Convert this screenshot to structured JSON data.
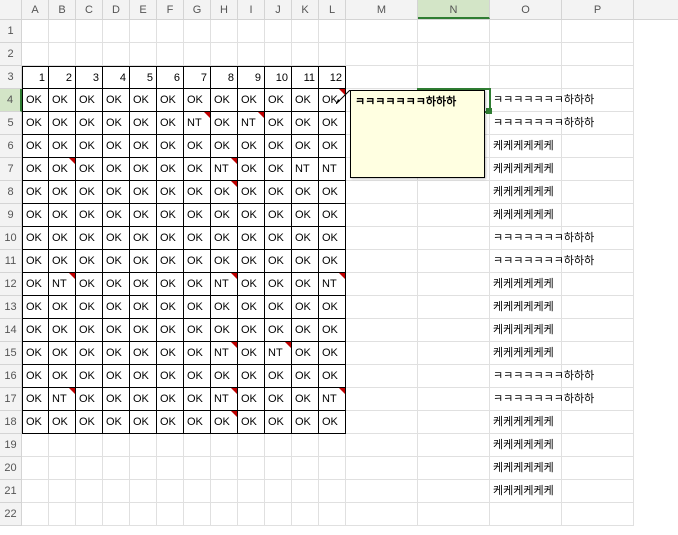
{
  "columns": [
    "A",
    "B",
    "C",
    "D",
    "E",
    "F",
    "G",
    "H",
    "I",
    "J",
    "K",
    "L",
    "M",
    "N",
    "O",
    "P"
  ],
  "col_widths": {
    "narrow": [
      "A",
      "B",
      "C",
      "D",
      "E",
      "F",
      "G",
      "H",
      "I",
      "J",
      "K",
      "L"
    ],
    "wide": [
      "M",
      "N",
      "O",
      "P"
    ]
  },
  "active_cell": "N4",
  "comment": {
    "anchor": "L4",
    "text": "ㅋㅋㅋㅋㅋㅋㅋ하하하"
  },
  "headers_row3": [
    "1",
    "2",
    "3",
    "4",
    "5",
    "6",
    "7",
    "8",
    "9",
    "10",
    "11",
    "12"
  ],
  "grid": {
    "4": {
      "cells": [
        "OK",
        "OK",
        "OK",
        "OK",
        "OK",
        "OK",
        "OK",
        "OK",
        "OK",
        "OK",
        "OK",
        "OK"
      ],
      "cm": [
        11
      ],
      "O": "ㅋㅋㅋㅋㅋㅋㅋ하하하"
    },
    "5": {
      "cells": [
        "OK",
        "OK",
        "OK",
        "OK",
        "OK",
        "OK",
        "NT",
        "OK",
        "NT",
        "OK",
        "OK",
        "OK"
      ],
      "cm": [
        6,
        8
      ],
      "O": "ㅋㅋㅋㅋㅋㅋㅋ하하하"
    },
    "6": {
      "cells": [
        "OK",
        "OK",
        "OK",
        "OK",
        "OK",
        "OK",
        "OK",
        "OK",
        "OK",
        "OK",
        "OK",
        "OK"
      ],
      "cm": [],
      "O": "케케케케케케"
    },
    "7": {
      "cells": [
        "OK",
        "OK",
        "OK",
        "OK",
        "OK",
        "OK",
        "OK",
        "NT",
        "OK",
        "OK",
        "NT",
        "NT"
      ],
      "cm": [
        1,
        7
      ],
      "O": "케케케케케케"
    },
    "8": {
      "cells": [
        "OK",
        "OK",
        "OK",
        "OK",
        "OK",
        "OK",
        "OK",
        "OK",
        "OK",
        "OK",
        "OK",
        "OK"
      ],
      "cm": [
        7
      ],
      "O": "케케케케케케"
    },
    "9": {
      "cells": [
        "OK",
        "OK",
        "OK",
        "OK",
        "OK",
        "OK",
        "OK",
        "OK",
        "OK",
        "OK",
        "OK",
        "OK"
      ],
      "cm": [],
      "O": "케케케케케케"
    },
    "10": {
      "cells": [
        "OK",
        "OK",
        "OK",
        "OK",
        "OK",
        "OK",
        "OK",
        "OK",
        "OK",
        "OK",
        "OK",
        "OK"
      ],
      "cm": [],
      "O": "ㅋㅋㅋㅋㅋㅋㅋ하하하"
    },
    "11": {
      "cells": [
        "OK",
        "OK",
        "OK",
        "OK",
        "OK",
        "OK",
        "OK",
        "OK",
        "OK",
        "OK",
        "OK",
        "OK"
      ],
      "cm": [],
      "O": "ㅋㅋㅋㅋㅋㅋㅋ하하하"
    },
    "12": {
      "cells": [
        "OK",
        "NT",
        "OK",
        "OK",
        "OK",
        "OK",
        "OK",
        "NT",
        "OK",
        "OK",
        "OK",
        "NT"
      ],
      "cm": [
        1,
        7,
        11
      ],
      "O": "케케케케케케"
    },
    "13": {
      "cells": [
        "OK",
        "OK",
        "OK",
        "OK",
        "OK",
        "OK",
        "OK",
        "OK",
        "OK",
        "OK",
        "OK",
        "OK"
      ],
      "cm": [],
      "O": "케케케케케케"
    },
    "14": {
      "cells": [
        "OK",
        "OK",
        "OK",
        "OK",
        "OK",
        "OK",
        "OK",
        "OK",
        "OK",
        "OK",
        "OK",
        "OK"
      ],
      "cm": [],
      "O": "케케케케케케"
    },
    "15": {
      "cells": [
        "OK",
        "OK",
        "OK",
        "OK",
        "OK",
        "OK",
        "OK",
        "NT",
        "OK",
        "NT",
        "OK",
        "OK"
      ],
      "cm": [
        7,
        9
      ],
      "O": "케케케케케케"
    },
    "16": {
      "cells": [
        "OK",
        "OK",
        "OK",
        "OK",
        "OK",
        "OK",
        "OK",
        "OK",
        "OK",
        "OK",
        "OK",
        "OK"
      ],
      "cm": [],
      "O": "ㅋㅋㅋㅋㅋㅋㅋ하하하"
    },
    "17": {
      "cells": [
        "OK",
        "NT",
        "OK",
        "OK",
        "OK",
        "OK",
        "OK",
        "NT",
        "OK",
        "OK",
        "OK",
        "NT"
      ],
      "cm": [
        1,
        7,
        11
      ],
      "O": "ㅋㅋㅋㅋㅋㅋㅋ하하하"
    },
    "18": {
      "cells": [
        "OK",
        "OK",
        "OK",
        "OK",
        "OK",
        "OK",
        "OK",
        "OK",
        "OK",
        "OK",
        "OK",
        "OK"
      ],
      "cm": [
        7
      ],
      "O": "케케케케케케"
    }
  },
  "extra_O": {
    "19": "케케케케케케",
    "20": "케케케케케케",
    "21": "케케케케케케"
  },
  "row_range": [
    1,
    22
  ]
}
